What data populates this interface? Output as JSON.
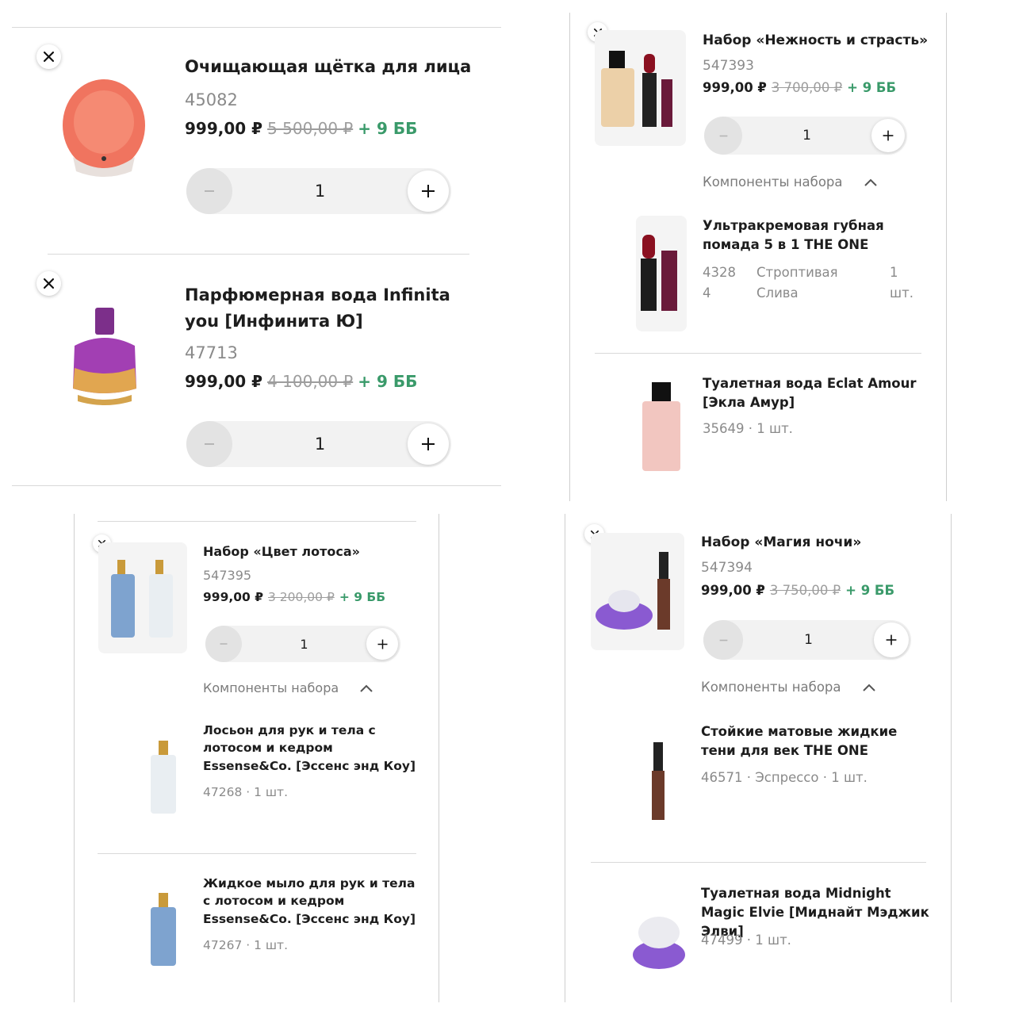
{
  "panel1": {
    "items": [
      {
        "title": "Очищающая щётка для лица",
        "sku": "45082",
        "price": "999,00 ₽",
        "old_price": "5 500,00 ₽",
        "bonus": "+ 9 ББ",
        "qty": "1"
      },
      {
        "title": "Парфюмерная вода Infinita you [Инфинита Ю]",
        "sku": "47713",
        "price": "999,00 ₽",
        "old_price": "4 100,00 ₽",
        "bonus": "+ 9 ББ",
        "qty": "1"
      }
    ]
  },
  "panel2": {
    "set": {
      "title": "Набор «Нежность и страсть»",
      "sku": "547393",
      "price": "999,00 ₽",
      "old_price": "3 700,00 ₽",
      "bonus": "+ 9 ББ",
      "qty": "1",
      "components_label": "Компоненты набора"
    },
    "components": [
      {
        "title": "Ультракремовая губная помада 5 в 1 THE ONE",
        "sku_a": "4328",
        "sku_b": "4",
        "shade_a": "Строптивая",
        "shade_b": "Слива",
        "qty_a": "1",
        "qty_b": "шт."
      },
      {
        "title": "Туалетная вода Eclat Amour [Экла Амур]",
        "meta": "35649 · 1 шт."
      }
    ]
  },
  "panel3": {
    "set": {
      "title": "Набор «Цвет лотоса»",
      "sku": "547395",
      "price": "999,00 ₽",
      "old_price": "3 200,00 ₽",
      "bonus": "+ 9 ББ",
      "qty": "1",
      "components_label": "Компоненты набора"
    },
    "components": [
      {
        "title": "Лосьон для рук и тела с лотосом и кедром Essense&Co. [Эссенс энд Коу]",
        "meta": "47268 · 1 шт."
      },
      {
        "title": "Жидкое мыло для рук и тела с лотосом и кедром Essense&Co. [Эссенс энд Коу]",
        "meta": "47267 · 1 шт."
      }
    ]
  },
  "panel4": {
    "set": {
      "title": "Набор «Магия ночи»",
      "sku": "547394",
      "price": "999,00 ₽",
      "old_price": "3 750,00 ₽",
      "bonus": "+ 9 ББ",
      "qty": "1",
      "components_label": "Компоненты набора"
    },
    "components": [
      {
        "title": "Стойкие матовые жидкие тени для век THE ONE",
        "meta": "46571 · Эспрессо · 1 шт."
      },
      {
        "title": "Туалетная вода Midnight Magic Elvie [Миднайт Мэджик Элви]",
        "meta": "47499 · 1 шт."
      }
    ]
  },
  "colors": {
    "bonus": "#3a9a6a",
    "muted": "#8a8a8a",
    "divider": "#d9d9d9"
  },
  "icons": {
    "remove": "close-icon",
    "decrease": "minus-icon",
    "increase": "plus-icon",
    "collapse": "chevron-up-icon"
  }
}
